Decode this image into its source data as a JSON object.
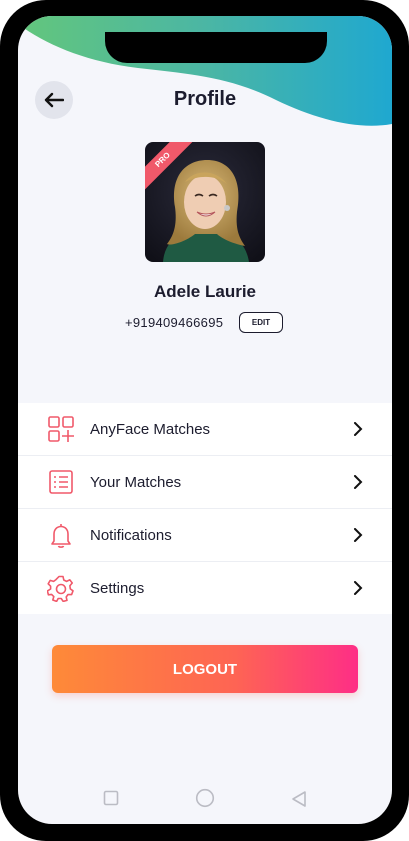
{
  "header": {
    "title": "Profile"
  },
  "profile": {
    "name": "Adele Laurie",
    "phone": "+919409466695",
    "edit_label": "EDIT",
    "badge": "PRO"
  },
  "menu": {
    "items": [
      {
        "label": "AnyFace Matches",
        "icon": "face-grid-plus-icon"
      },
      {
        "label": "Your Matches",
        "icon": "list-icon"
      },
      {
        "label": "Notifications",
        "icon": "bell-icon"
      },
      {
        "label": "Settings",
        "icon": "gear-icon"
      }
    ]
  },
  "logout_label": "LOGOUT",
  "colors": {
    "accent": "#f0596a",
    "gradient_start": "#fe8a38",
    "gradient_end": "#fe2e86",
    "wave_start": "#63c67c",
    "wave_end": "#1fa8d0"
  },
  "navigation_bar": {
    "buttons": [
      "square-icon",
      "circle-icon",
      "triangle-back-icon"
    ]
  }
}
